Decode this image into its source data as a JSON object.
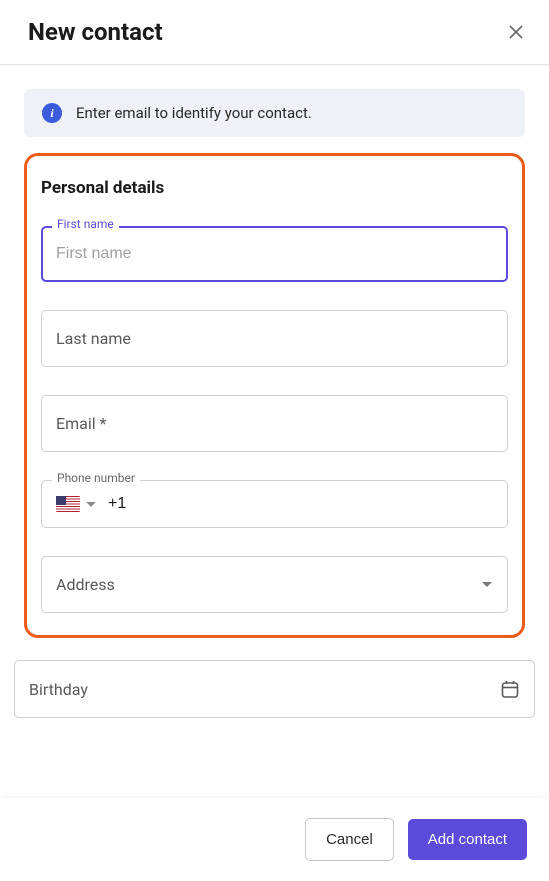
{
  "header": {
    "title": "New contact"
  },
  "banner": {
    "text": "Enter email to identify your contact."
  },
  "section": {
    "title": "Personal details",
    "fields": {
      "first_name": {
        "label": "First name",
        "placeholder": "First name",
        "value": ""
      },
      "last_name": {
        "label": "Last name",
        "value": ""
      },
      "email": {
        "label": "Email *",
        "value": ""
      },
      "phone": {
        "label": "Phone number",
        "country_code": "+1",
        "value": ""
      },
      "address": {
        "label": "Address",
        "value": ""
      }
    }
  },
  "extra_fields": {
    "birthday": {
      "label": "Birthday",
      "value": ""
    }
  },
  "footer": {
    "cancel": "Cancel",
    "submit": "Add contact"
  }
}
